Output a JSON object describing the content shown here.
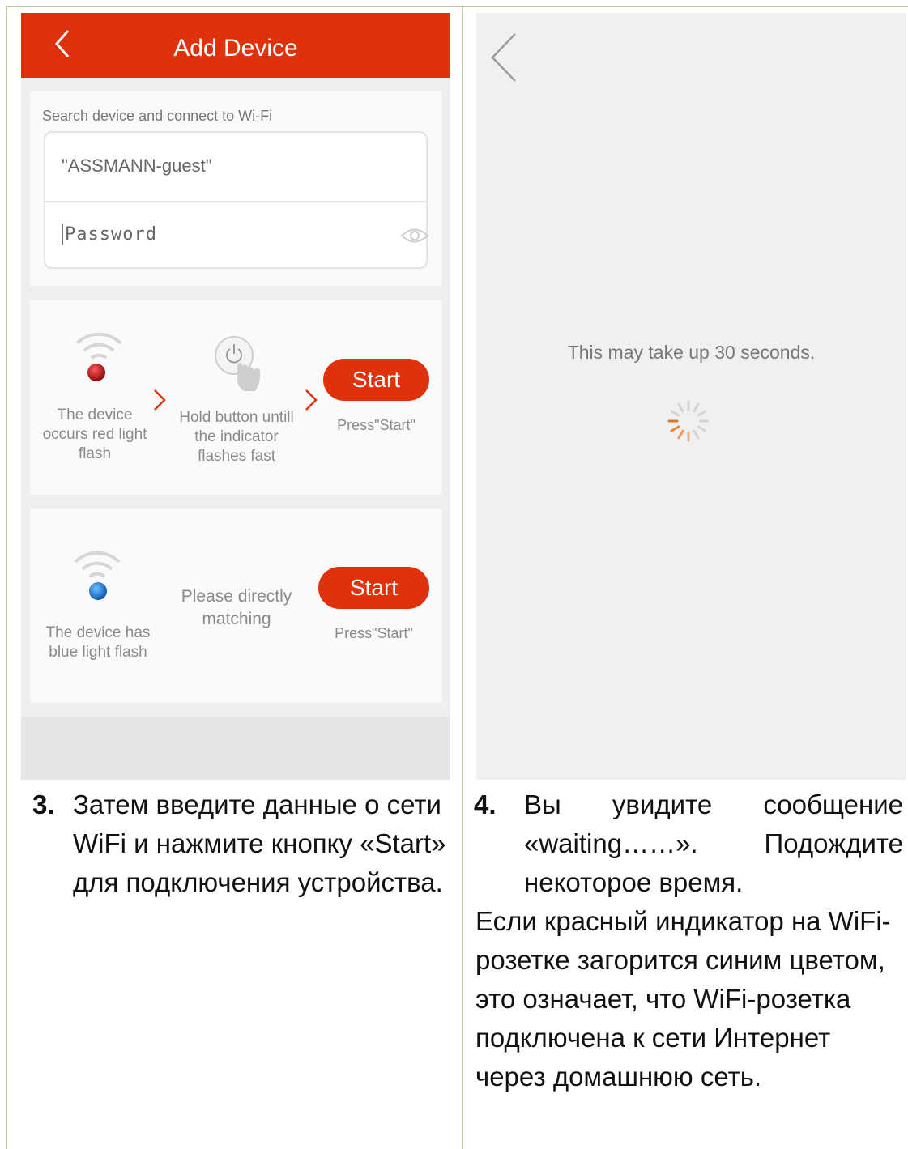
{
  "left_screen": {
    "header": {
      "title": "Add Device"
    },
    "wifi_form": {
      "label": "Search device and connect to Wi-Fi",
      "ssid_value": "\"ASSMANN-guest\"",
      "password_placeholder": "Password"
    },
    "mode_red": {
      "step1_caption": "The device occurs red light flash",
      "step2_caption": "Hold button untill the indicator flashes fast",
      "start_label": "Start",
      "press_label": "Press\"Start\"",
      "led_color": "#c81212"
    },
    "mode_blue": {
      "step1_caption": "The device has blue light flash",
      "step2_caption": "Please directly matching",
      "start_label": "Start",
      "press_label": "Press\"Start\"",
      "led_color": "#1f7fe0"
    }
  },
  "right_screen": {
    "message": "This may take up 30 seconds."
  },
  "instructions": {
    "step3": {
      "number": "3.",
      "text": "Затем введите данные о сети WiFi и нажмите кнопку «Start» для подключения устройства."
    },
    "step4": {
      "number": "4.",
      "text": "Вы увидите сообщение «waiting……». Подождите некоторое время.",
      "after": "Если красный индикатор на WiFi-розетке загорится синим цветом, это означает, что WiFi-розетка подключена к сети Интернет через домашнюю сеть."
    }
  },
  "colors": {
    "accent": "#e0310d",
    "frame_border": "#c9c2a2"
  }
}
